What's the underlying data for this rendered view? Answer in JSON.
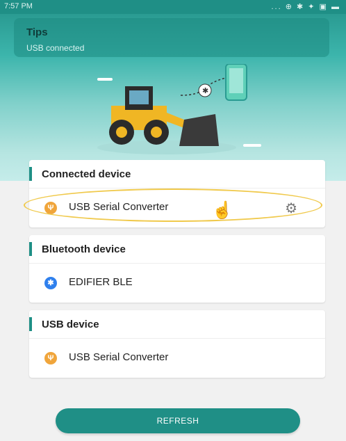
{
  "status_bar": {
    "time": "7:57 PM",
    "icons": "... ⊕ ✱ ✦ ▣ ▬"
  },
  "tips": {
    "title": "Tips",
    "subtitle": "USB connected"
  },
  "cards": [
    {
      "title": "Connected device",
      "items": [
        {
          "label": "USB Serial Converter",
          "icon": "usb-icon",
          "has_settings": true
        }
      ]
    },
    {
      "title": "Bluetooth device",
      "items": [
        {
          "label": "EDIFIER BLE",
          "icon": "bluetooth-icon"
        }
      ]
    },
    {
      "title": "USB device",
      "items": [
        {
          "label": "USB Serial Converter",
          "icon": "usb-icon"
        }
      ]
    }
  ],
  "refresh_button": {
    "label": "REFRESH"
  },
  "colors": {
    "accent": "#1f8f86",
    "usb_icon": "#f0a53b",
    "bluetooth_icon": "#2f80ed",
    "highlight": "#f0c94b"
  }
}
